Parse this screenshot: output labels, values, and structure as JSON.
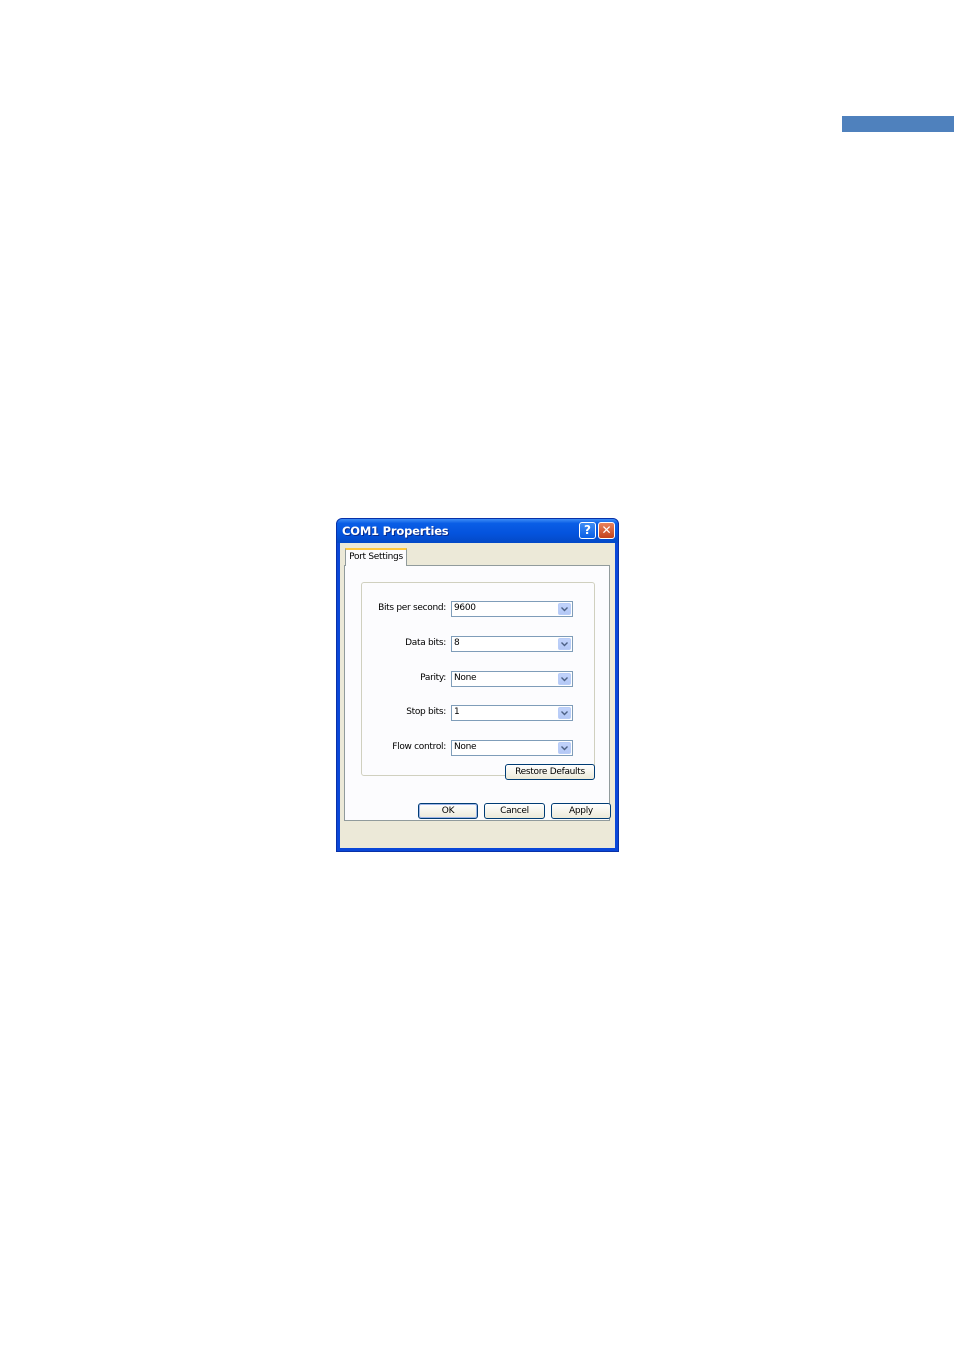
{
  "dialog": {
    "title": "COM1 Properties",
    "help_glyph": "?",
    "close_glyph": "✕",
    "tab_label": "Port Settings",
    "fields": [
      {
        "label": "Bits per second:",
        "value": "9600"
      },
      {
        "label": "Data bits:",
        "value": "8"
      },
      {
        "label": "Parity:",
        "value": "None"
      },
      {
        "label": "Stop bits:",
        "value": "1"
      },
      {
        "label": "Flow control:",
        "value": "None"
      }
    ],
    "restore_defaults_label": "Restore Defaults",
    "ok_label": "OK",
    "cancel_label": "Cancel",
    "apply_label": "Apply"
  },
  "colors": {
    "page_accent": "#4f81bd",
    "titlebar": "#0a5ee6",
    "dialog_face": "#ece9d8"
  },
  "icons": [
    "help-icon",
    "close-icon",
    "chevron-down-icon"
  ]
}
